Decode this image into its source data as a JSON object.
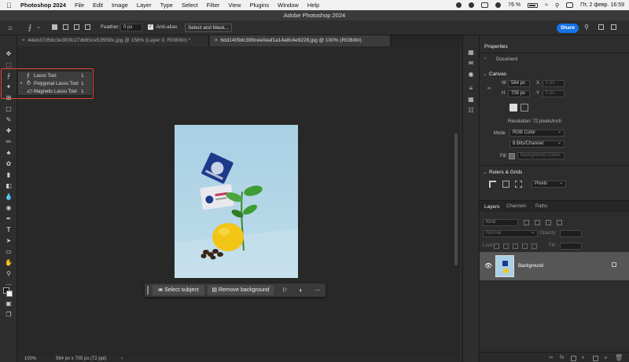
{
  "menubar": {
    "app_name": "Photoshop 2024",
    "items": [
      "File",
      "Edit",
      "Image",
      "Layer",
      "Type",
      "Select",
      "Filter",
      "View",
      "Plugins",
      "Window",
      "Help"
    ],
    "battery": "76 %",
    "datetime": "Пт, 2 февр.  16:59"
  },
  "window": {
    "title": "Adobe Photoshop 2024"
  },
  "options_bar": {
    "feather_label": "Feather:",
    "feather_value": "0 px",
    "antialias_label": "Anti-alias",
    "select_mask_label": "Select and Mask...",
    "share_label": "Share"
  },
  "tabs": [
    {
      "label": "4deb37d56c3e383fc27db65ce53f958c.jpg @ 158% (Layer 0, RGB/8#) *"
    },
    {
      "label": "6dd1409dc399cee0eaf1a14a8c4e9228.jpg @ 100% (RGB/8#)"
    }
  ],
  "flyout": {
    "items": [
      {
        "label": "Lasso Tool",
        "shortcut": "L",
        "icon": "lasso-icon"
      },
      {
        "label": "Polygonal Lasso Tool",
        "shortcut": "L",
        "icon": "polygonal-lasso-icon"
      },
      {
        "label": "Magnetic Lasso Tool",
        "shortcut": "L",
        "icon": "magnetic-lasso-icon"
      }
    ]
  },
  "context_bar": {
    "select_subject": "Select subject",
    "remove_background": "Remove background"
  },
  "properties": {
    "title": "Properties",
    "document_label": "Document",
    "canvas_title": "Canvas",
    "w_label": "W",
    "w_value": "564 px",
    "h_label": "H",
    "h_value": "705 px",
    "x_label": "X",
    "x_value": "0 px",
    "y_label": "Y",
    "y_value": "0 px",
    "resolution": "Resolution: 72 pixels/inch",
    "mode_label": "Mode",
    "mode_value": "RGB Color",
    "bits_value": "8 Bits/Channel",
    "fill_label": "Fill",
    "fill_value": "Background Color",
    "rulers_title": "Rulers & Grids",
    "units_value": "Pixels"
  },
  "layers_panel": {
    "tabs": [
      "Layers",
      "Channels",
      "Paths"
    ],
    "kind_label": "Kind",
    "blend_mode": "Normal",
    "opacity_label": "Opacity:",
    "lock_label": "Lock:",
    "fill_label": "Fill:",
    "layer_name": "Background"
  },
  "status": {
    "zoom": "100%",
    "doc_info": "564 px x 705 px (72 ppi)"
  },
  "colors": {
    "accent": "#1473e6",
    "highlight_outline": "#e0453a"
  }
}
